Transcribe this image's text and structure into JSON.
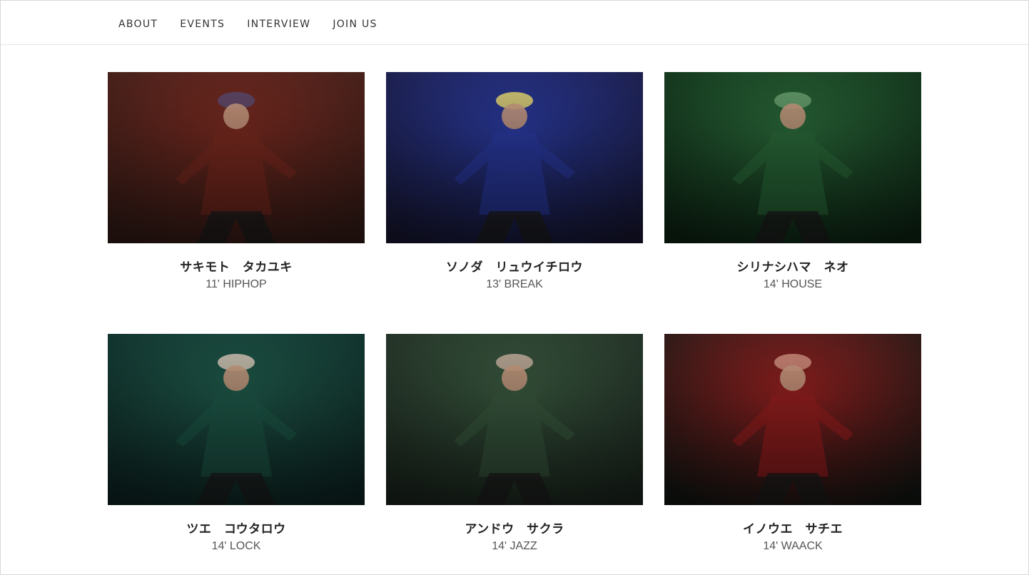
{
  "nav": {
    "items": [
      "ABOUT",
      "EVENTS",
      "INTERVIEW",
      "JOIN US"
    ]
  },
  "members": [
    {
      "name": "サキモト　タカユキ",
      "meta": "11' HIPHOP",
      "tone": "#3a1f1a",
      "accent": "#7a2a20",
      "glow": "#5a4a70"
    },
    {
      "name": "ソノダ　リュウイチロウ",
      "meta": "13' BREAK",
      "tone": "#1a1a3a",
      "accent": "#2a3aa0",
      "glow": "#e8d870"
    },
    {
      "name": "シリナシハマ　ネオ",
      "meta": "14' HOUSE",
      "tone": "#0f2a16",
      "accent": "#2a6a3a",
      "glow": "#6aa070"
    },
    {
      "name": "ツエ　コウタロウ",
      "meta": "14' LOCK",
      "tone": "#0f2a28",
      "accent": "#1f5a4a",
      "glow": "#d8c8b8"
    },
    {
      "name": "アンドウ　サクラ",
      "meta": "14' JAZZ",
      "tone": "#1f2a22",
      "accent": "#3a5a40",
      "glow": "#c8b0a0"
    },
    {
      "name": "イノウエ　サチエ",
      "meta": "14' WAACK",
      "tone": "#151a16",
      "accent": "#9a2020",
      "glow": "#d09080"
    }
  ]
}
